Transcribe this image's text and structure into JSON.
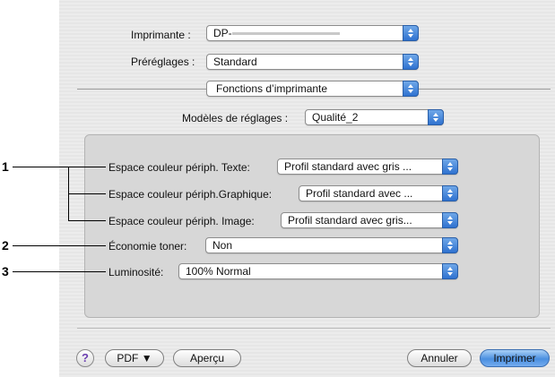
{
  "printer": {
    "label": "Imprimante :",
    "value": "DP-"
  },
  "presets": {
    "label": "Préréglages :",
    "value": "Standard"
  },
  "panel": {
    "value": "Fonctions d’imprimante"
  },
  "models": {
    "label": "Modèles de réglages :",
    "value": "Qualité_2"
  },
  "settings": [
    {
      "label": "Espace couleur périph. Texte:",
      "value": "Profil standard avec gris ..."
    },
    {
      "label": "Espace couleur périph.Graphique:",
      "value": "Profil standard avec ..."
    },
    {
      "label": "Espace couleur périph. Image:",
      "value": "Profil standard avec gris..."
    },
    {
      "label": "Économie toner:",
      "value": "Non"
    },
    {
      "label": "Luminosité:",
      "value": "100% Normal"
    }
  ],
  "callouts": [
    "1",
    "2",
    "3"
  ],
  "buttons": {
    "help": "?",
    "pdf": "PDF ▼",
    "preview": "Aperçu",
    "cancel": "Annuler",
    "print": "Imprimer"
  },
  "colors": {
    "accent": "#3b82d6",
    "background": "#ececec"
  }
}
